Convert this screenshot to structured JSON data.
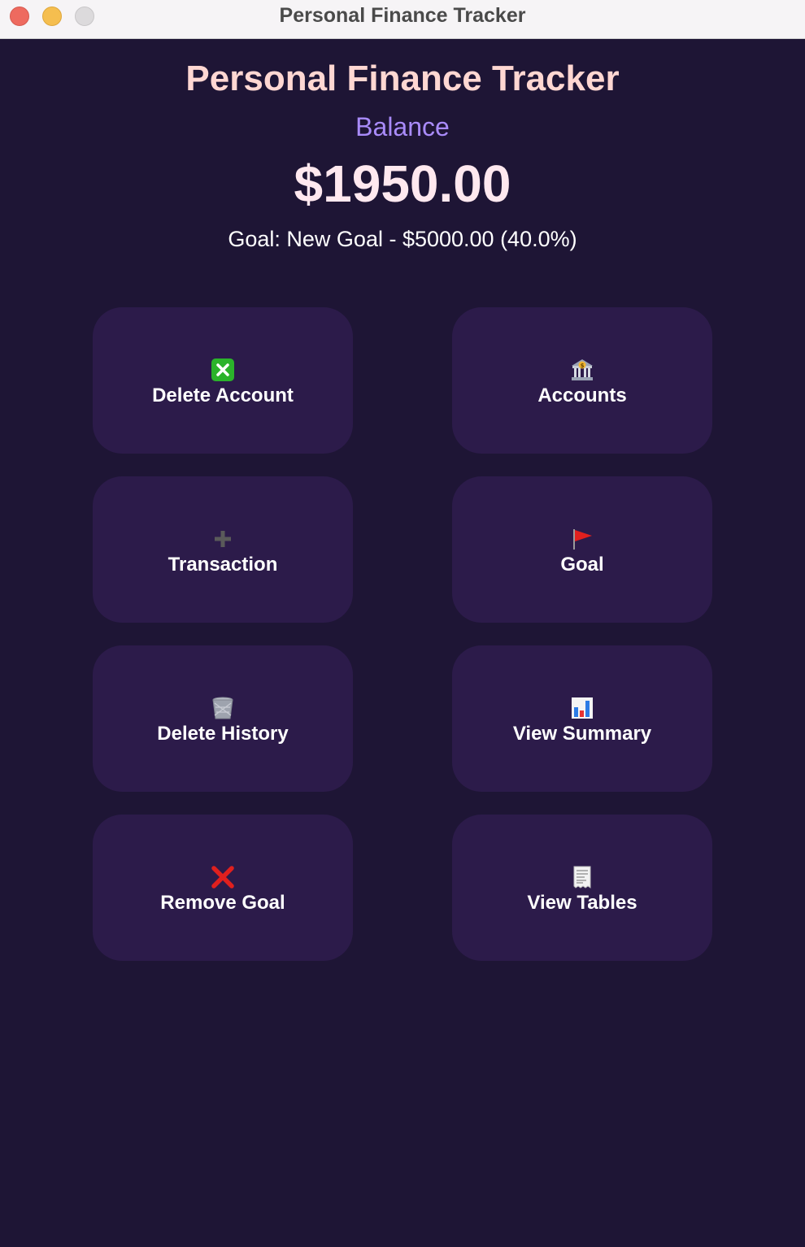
{
  "window": {
    "title": "Personal Finance Tracker"
  },
  "header": {
    "app_title": "Personal Finance Tracker",
    "balance_label": "Balance",
    "balance_value": "$1950.00",
    "goal_text": "Goal: New Goal - $5000.00 (40.0%)"
  },
  "colors": {
    "background": "#1e1535",
    "card": "#2c1b4a",
    "title": "#ffd7d2",
    "balance_label": "#a98bfa",
    "balance_value": "#ffe8ef"
  },
  "buttons": [
    {
      "label": "Delete Account",
      "icon": "cross-mark-button-icon"
    },
    {
      "label": "Accounts",
      "icon": "bank-icon"
    },
    {
      "label": "Transaction",
      "icon": "plus-icon"
    },
    {
      "label": "Goal",
      "icon": "red-flag-icon"
    },
    {
      "label": "Delete History",
      "icon": "wastebasket-icon"
    },
    {
      "label": "View Summary",
      "icon": "bar-chart-icon"
    },
    {
      "label": "Remove Goal",
      "icon": "red-x-icon"
    },
    {
      "label": "View Tables",
      "icon": "receipt-icon"
    }
  ]
}
